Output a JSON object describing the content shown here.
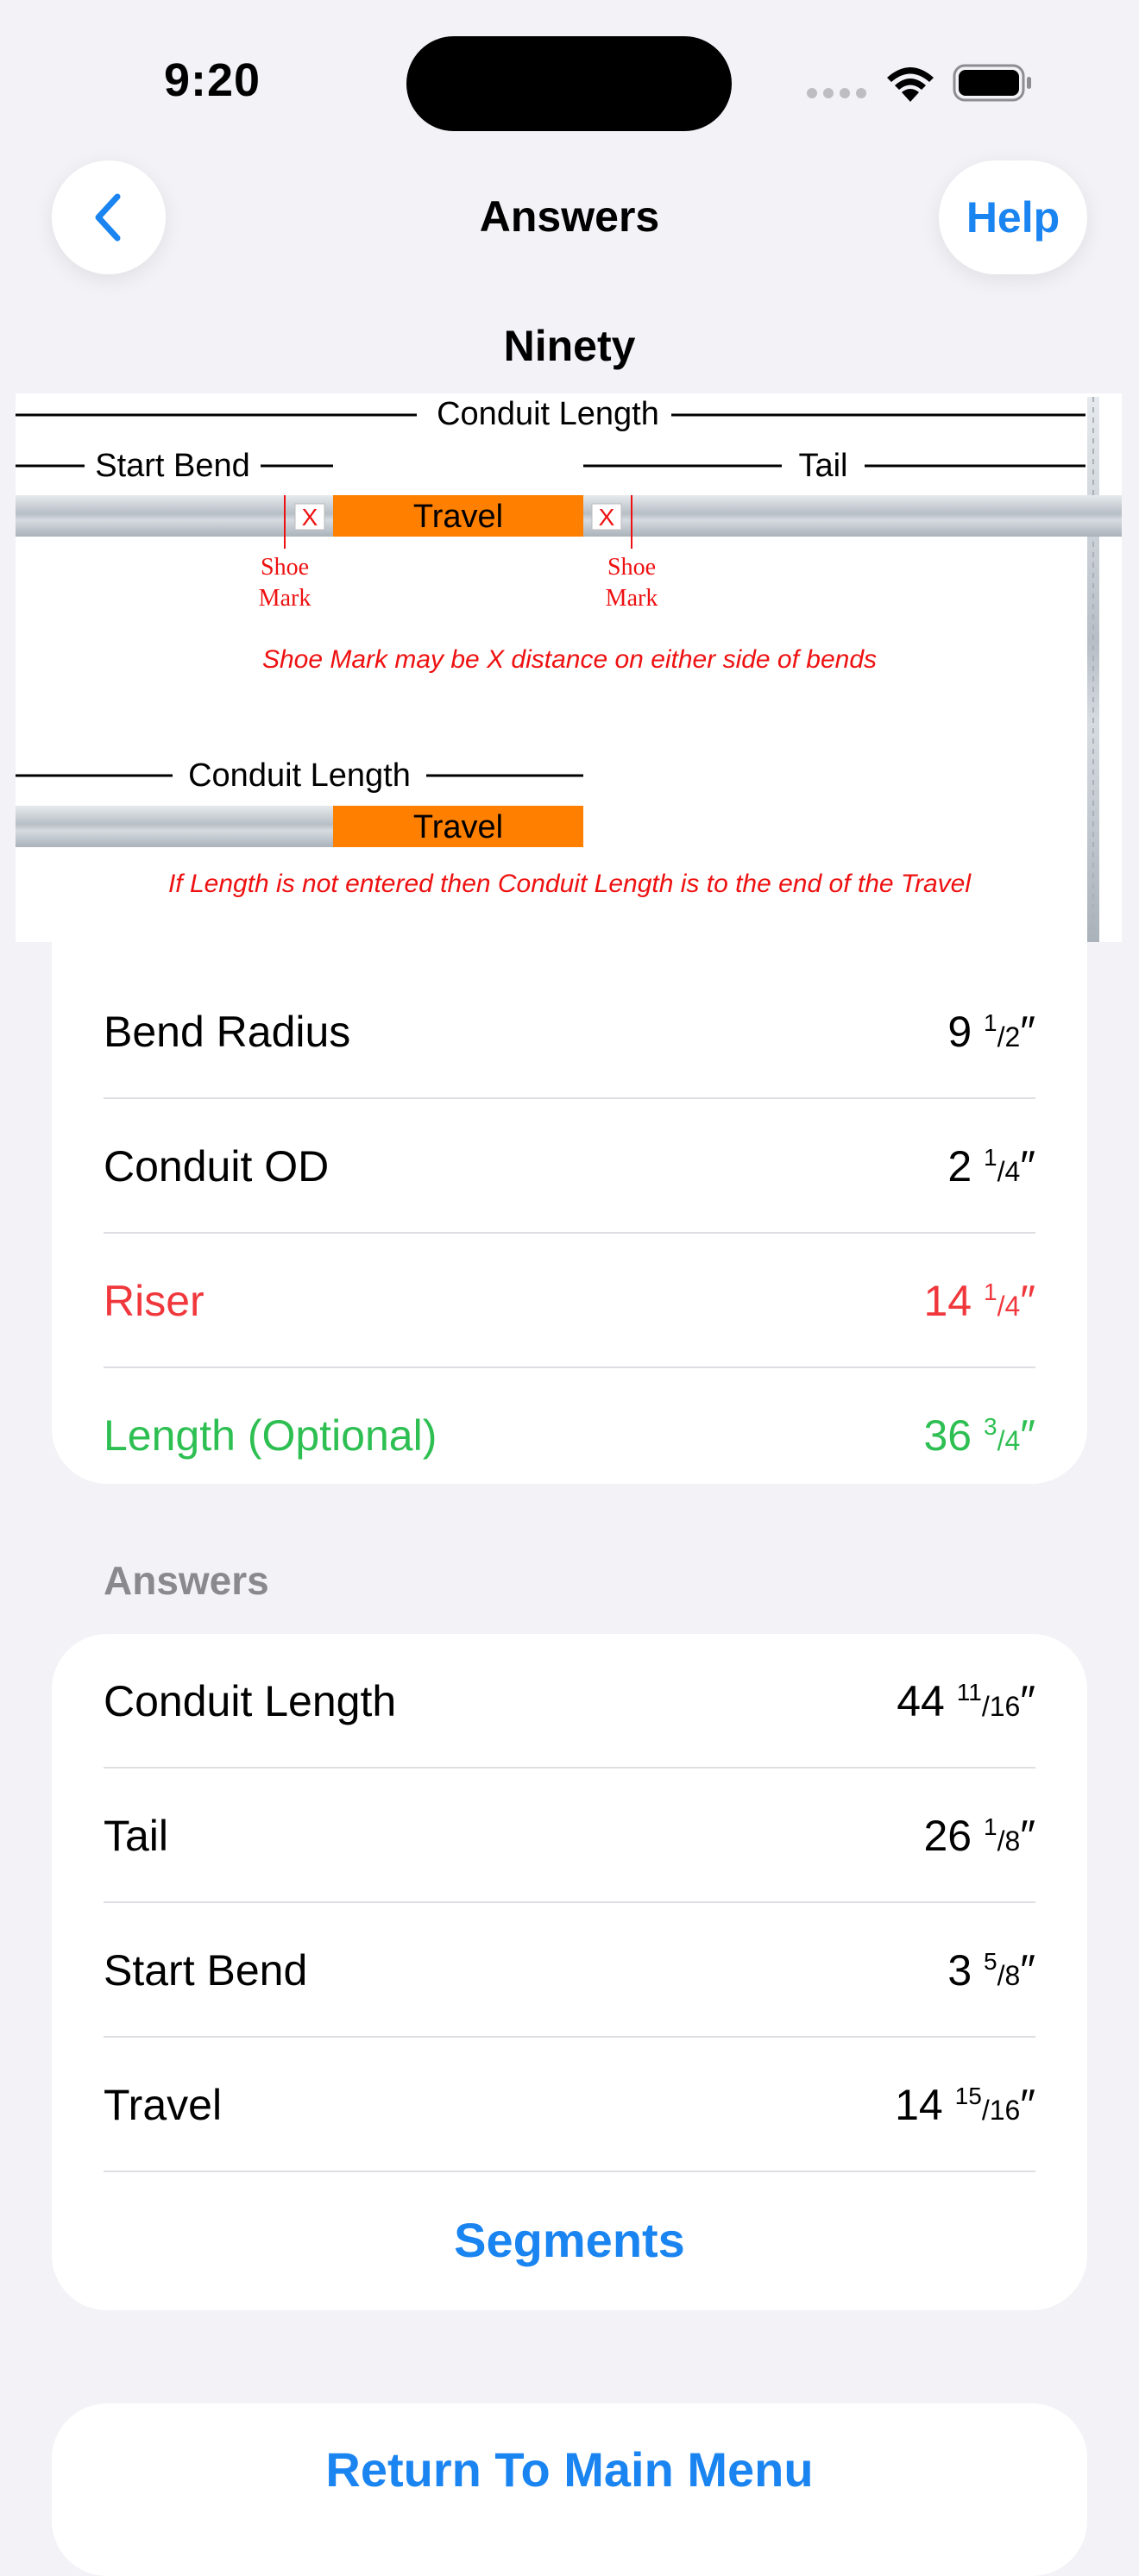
{
  "status_bar": {
    "time": "9:20"
  },
  "nav": {
    "title": "Answers",
    "help_label": "Help"
  },
  "section_title": "Ninety",
  "diagram": {
    "top": {
      "conduit_length_label": "Conduit Length",
      "start_bend_label": "Start Bend",
      "tail_label": "Tail",
      "travel_label": "Travel",
      "x_mark": "X",
      "shoe_mark_line1": "Shoe",
      "shoe_mark_line2": "Mark",
      "note": "Shoe Mark may be X distance on either side of bends"
    },
    "bottom": {
      "conduit_length_label": "Conduit Length",
      "travel_label": "Travel",
      "note": "If Length is not entered then Conduit Length is to the end of the Travel"
    },
    "colors": {
      "travel": "#ff7f00",
      "note_red": "#ee1111",
      "pipe": "#c8ced3"
    }
  },
  "inputs": [
    {
      "label": "Bend Radius",
      "whole": "9",
      "num": "1",
      "den": "2",
      "unit": "″"
    },
    {
      "label": "Conduit OD",
      "whole": "2",
      "num": "1",
      "den": "4",
      "unit": "″"
    },
    {
      "label": "Riser",
      "whole": "14",
      "num": "1",
      "den": "4",
      "unit": "″",
      "color": "#f0373c"
    },
    {
      "label": "Length (Optional)",
      "whole": "36",
      "num": "3",
      "den": "4",
      "unit": "″",
      "color": "#2ebf52"
    }
  ],
  "answers_section_label": "Answers",
  "answers": [
    {
      "label": "Conduit Length",
      "whole": "44",
      "num": "11",
      "den": "16",
      "unit": "″"
    },
    {
      "label": "Tail",
      "whole": "26",
      "num": "1",
      "den": "8",
      "unit": "″"
    },
    {
      "label": "Start Bend",
      "whole": "3",
      "num": "5",
      "den": "8",
      "unit": "″"
    },
    {
      "label": "Travel",
      "whole": "14",
      "num": "15",
      "den": "16",
      "unit": "″"
    }
  ],
  "segments_label": "Segments",
  "return_label": "Return To Main Menu",
  "accent_color": "#1a84f0"
}
